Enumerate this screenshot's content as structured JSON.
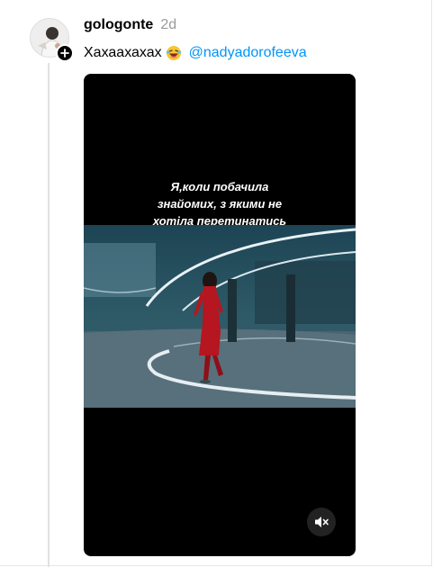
{
  "post": {
    "username": "gologonte",
    "timestamp": "2d",
    "caption_text": "Хахаахахах",
    "caption_emoji": "laughing-face-emoji",
    "mention": "@nadyadorofeeva"
  },
  "video": {
    "overlay_lines": [
      "Я,коли побачила",
      "знайомих, з якими не",
      "хотіла перетинатись"
    ],
    "mute_icon": "speaker-muted-icon"
  },
  "icons": {
    "follow_badge": "plus-icon",
    "avatar": "avatar"
  },
  "colors": {
    "mention": "#0095f6",
    "timestamp": "#9a9a9a",
    "video_background": "#000000",
    "dress": "#c0161d"
  }
}
